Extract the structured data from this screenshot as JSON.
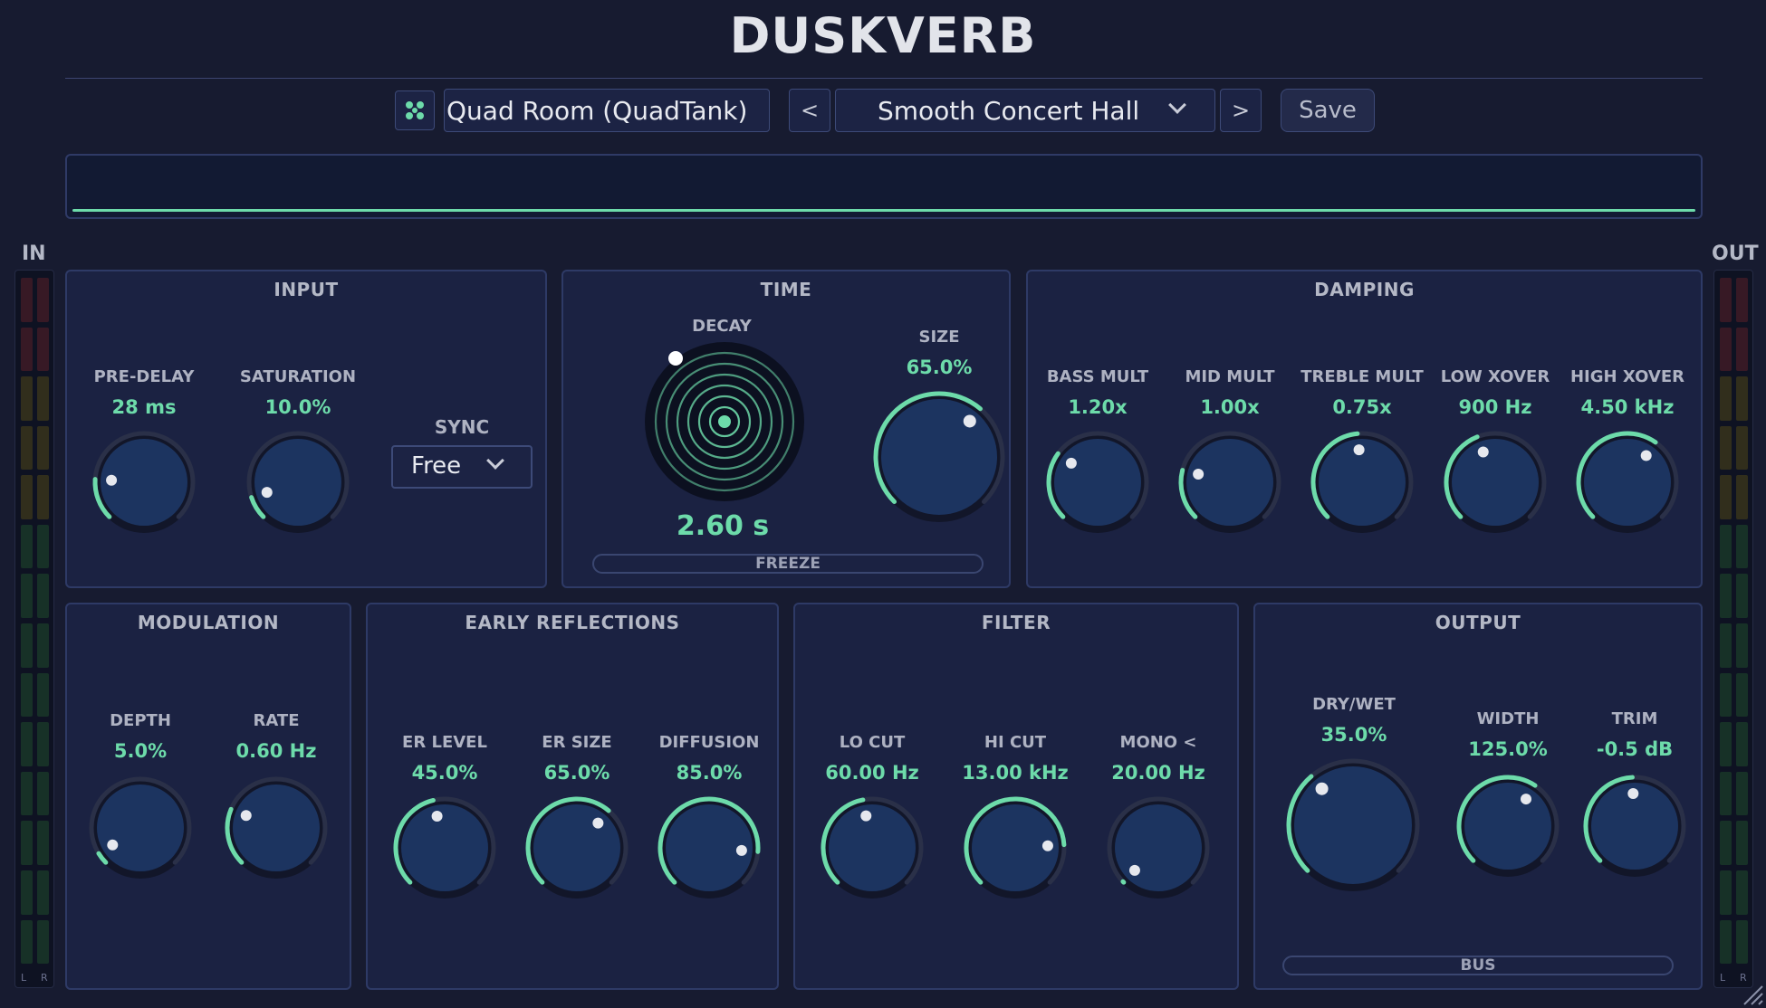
{
  "app": {
    "title": "DUSKVERB"
  },
  "toolbar": {
    "algorithm": "Quad Room (QuadTank)",
    "preset": "Smooth Concert Hall",
    "prev_label": "<",
    "next_label": ">",
    "save_label": "Save"
  },
  "meters": {
    "in_label": "IN",
    "out_label": "OUT",
    "left_label": "L",
    "right_label": "R"
  },
  "colors": {
    "accent": "#6ddbaa",
    "knob_fill": "#1c3460",
    "knob_track": "#2a3048",
    "panel": "#1b2242",
    "background": "#171b30"
  },
  "sections": {
    "input": {
      "title": "INPUT",
      "sync_label": "SYNC",
      "sync_value": "Free",
      "knobs": [
        {
          "label": "PRE-DELAY",
          "value": "28 ms",
          "level": 0.18
        },
        {
          "label": "SATURATION",
          "value": "10.0%",
          "level": 0.1
        }
      ]
    },
    "time": {
      "title": "TIME",
      "decay_label": "DECAY",
      "decay_value": "2.60 s",
      "freeze_label": "FREEZE",
      "knobs": [
        {
          "label": "SIZE",
          "value": "65.0%",
          "level": 0.65
        }
      ]
    },
    "damping": {
      "title": "DAMPING",
      "knobs": [
        {
          "label": "BASS MULT",
          "value": "1.20x",
          "level": 0.3
        },
        {
          "label": "MID MULT",
          "value": "1.00x",
          "level": 0.22
        },
        {
          "label": "TREBLE MULT",
          "value": "0.75x",
          "level": 0.48
        },
        {
          "label": "LOW XOVER",
          "value": "900 Hz",
          "level": 0.42
        },
        {
          "label": "HIGH XOVER",
          "value": "4.50 kHz",
          "level": 0.63
        }
      ]
    },
    "modulation": {
      "title": "MODULATION",
      "knobs": [
        {
          "label": "DEPTH",
          "value": "5.0%",
          "level": 0.05
        },
        {
          "label": "RATE",
          "value": "0.60 Hz",
          "level": 0.25
        }
      ]
    },
    "early_reflections": {
      "title": "EARLY REFLECTIONS",
      "knobs": [
        {
          "label": "ER LEVEL",
          "value": "45.0%",
          "level": 0.45
        },
        {
          "label": "ER SIZE",
          "value": "65.0%",
          "level": 0.65
        },
        {
          "label": "DIFFUSION",
          "value": "85.0%",
          "level": 0.85
        }
      ]
    },
    "filter": {
      "title": "FILTER",
      "knobs": [
        {
          "label": "LO CUT",
          "value": "60.00 Hz",
          "level": 0.46
        },
        {
          "label": "HI CUT",
          "value": "13.00 kHz",
          "level": 0.82
        },
        {
          "label": "MONO <",
          "value": "20.00 Hz",
          "level": 0.0
        }
      ]
    },
    "output": {
      "title": "OUTPUT",
      "bus_label": "BUS",
      "knobs": [
        {
          "label": "DRY/WET",
          "value": "35.0%",
          "level": 0.35
        },
        {
          "label": "WIDTH",
          "value": "125.0%",
          "level": 0.625
        },
        {
          "label": "TRIM",
          "value": "-0.5 dB",
          "level": 0.49
        }
      ]
    }
  }
}
